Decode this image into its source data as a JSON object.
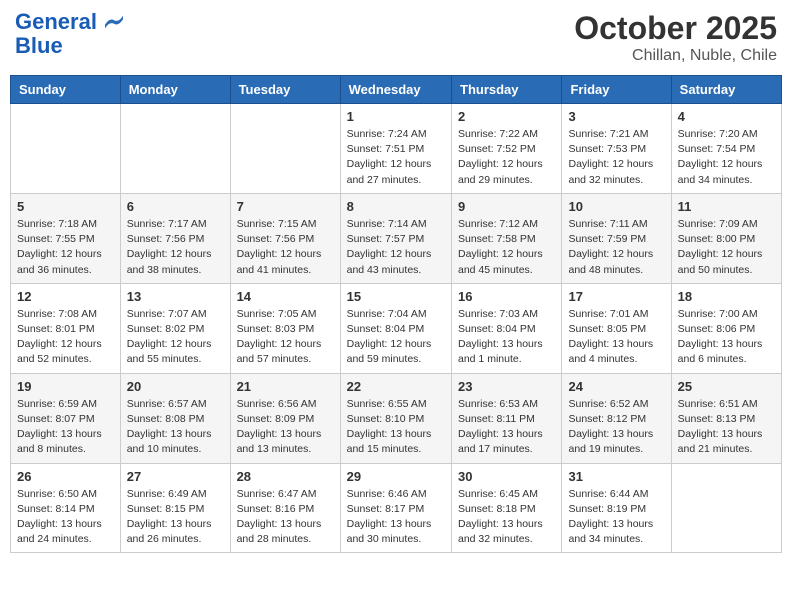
{
  "header": {
    "logo_line1": "General",
    "logo_line2": "Blue",
    "month": "October 2025",
    "location": "Chillan, Nuble, Chile"
  },
  "weekdays": [
    "Sunday",
    "Monday",
    "Tuesday",
    "Wednesday",
    "Thursday",
    "Friday",
    "Saturday"
  ],
  "weeks": [
    [
      {
        "day": "",
        "info": ""
      },
      {
        "day": "",
        "info": ""
      },
      {
        "day": "",
        "info": ""
      },
      {
        "day": "1",
        "info": "Sunrise: 7:24 AM\nSunset: 7:51 PM\nDaylight: 12 hours\nand 27 minutes."
      },
      {
        "day": "2",
        "info": "Sunrise: 7:22 AM\nSunset: 7:52 PM\nDaylight: 12 hours\nand 29 minutes."
      },
      {
        "day": "3",
        "info": "Sunrise: 7:21 AM\nSunset: 7:53 PM\nDaylight: 12 hours\nand 32 minutes."
      },
      {
        "day": "4",
        "info": "Sunrise: 7:20 AM\nSunset: 7:54 PM\nDaylight: 12 hours\nand 34 minutes."
      }
    ],
    [
      {
        "day": "5",
        "info": "Sunrise: 7:18 AM\nSunset: 7:55 PM\nDaylight: 12 hours\nand 36 minutes."
      },
      {
        "day": "6",
        "info": "Sunrise: 7:17 AM\nSunset: 7:56 PM\nDaylight: 12 hours\nand 38 minutes."
      },
      {
        "day": "7",
        "info": "Sunrise: 7:15 AM\nSunset: 7:56 PM\nDaylight: 12 hours\nand 41 minutes."
      },
      {
        "day": "8",
        "info": "Sunrise: 7:14 AM\nSunset: 7:57 PM\nDaylight: 12 hours\nand 43 minutes."
      },
      {
        "day": "9",
        "info": "Sunrise: 7:12 AM\nSunset: 7:58 PM\nDaylight: 12 hours\nand 45 minutes."
      },
      {
        "day": "10",
        "info": "Sunrise: 7:11 AM\nSunset: 7:59 PM\nDaylight: 12 hours\nand 48 minutes."
      },
      {
        "day": "11",
        "info": "Sunrise: 7:09 AM\nSunset: 8:00 PM\nDaylight: 12 hours\nand 50 minutes."
      }
    ],
    [
      {
        "day": "12",
        "info": "Sunrise: 7:08 AM\nSunset: 8:01 PM\nDaylight: 12 hours\nand 52 minutes."
      },
      {
        "day": "13",
        "info": "Sunrise: 7:07 AM\nSunset: 8:02 PM\nDaylight: 12 hours\nand 55 minutes."
      },
      {
        "day": "14",
        "info": "Sunrise: 7:05 AM\nSunset: 8:03 PM\nDaylight: 12 hours\nand 57 minutes."
      },
      {
        "day": "15",
        "info": "Sunrise: 7:04 AM\nSunset: 8:04 PM\nDaylight: 12 hours\nand 59 minutes."
      },
      {
        "day": "16",
        "info": "Sunrise: 7:03 AM\nSunset: 8:04 PM\nDaylight: 13 hours\nand 1 minute."
      },
      {
        "day": "17",
        "info": "Sunrise: 7:01 AM\nSunset: 8:05 PM\nDaylight: 13 hours\nand 4 minutes."
      },
      {
        "day": "18",
        "info": "Sunrise: 7:00 AM\nSunset: 8:06 PM\nDaylight: 13 hours\nand 6 minutes."
      }
    ],
    [
      {
        "day": "19",
        "info": "Sunrise: 6:59 AM\nSunset: 8:07 PM\nDaylight: 13 hours\nand 8 minutes."
      },
      {
        "day": "20",
        "info": "Sunrise: 6:57 AM\nSunset: 8:08 PM\nDaylight: 13 hours\nand 10 minutes."
      },
      {
        "day": "21",
        "info": "Sunrise: 6:56 AM\nSunset: 8:09 PM\nDaylight: 13 hours\nand 13 minutes."
      },
      {
        "day": "22",
        "info": "Sunrise: 6:55 AM\nSunset: 8:10 PM\nDaylight: 13 hours\nand 15 minutes."
      },
      {
        "day": "23",
        "info": "Sunrise: 6:53 AM\nSunset: 8:11 PM\nDaylight: 13 hours\nand 17 minutes."
      },
      {
        "day": "24",
        "info": "Sunrise: 6:52 AM\nSunset: 8:12 PM\nDaylight: 13 hours\nand 19 minutes."
      },
      {
        "day": "25",
        "info": "Sunrise: 6:51 AM\nSunset: 8:13 PM\nDaylight: 13 hours\nand 21 minutes."
      }
    ],
    [
      {
        "day": "26",
        "info": "Sunrise: 6:50 AM\nSunset: 8:14 PM\nDaylight: 13 hours\nand 24 minutes."
      },
      {
        "day": "27",
        "info": "Sunrise: 6:49 AM\nSunset: 8:15 PM\nDaylight: 13 hours\nand 26 minutes."
      },
      {
        "day": "28",
        "info": "Sunrise: 6:47 AM\nSunset: 8:16 PM\nDaylight: 13 hours\nand 28 minutes."
      },
      {
        "day": "29",
        "info": "Sunrise: 6:46 AM\nSunset: 8:17 PM\nDaylight: 13 hours\nand 30 minutes."
      },
      {
        "day": "30",
        "info": "Sunrise: 6:45 AM\nSunset: 8:18 PM\nDaylight: 13 hours\nand 32 minutes."
      },
      {
        "day": "31",
        "info": "Sunrise: 6:44 AM\nSunset: 8:19 PM\nDaylight: 13 hours\nand 34 minutes."
      },
      {
        "day": "",
        "info": ""
      }
    ]
  ]
}
